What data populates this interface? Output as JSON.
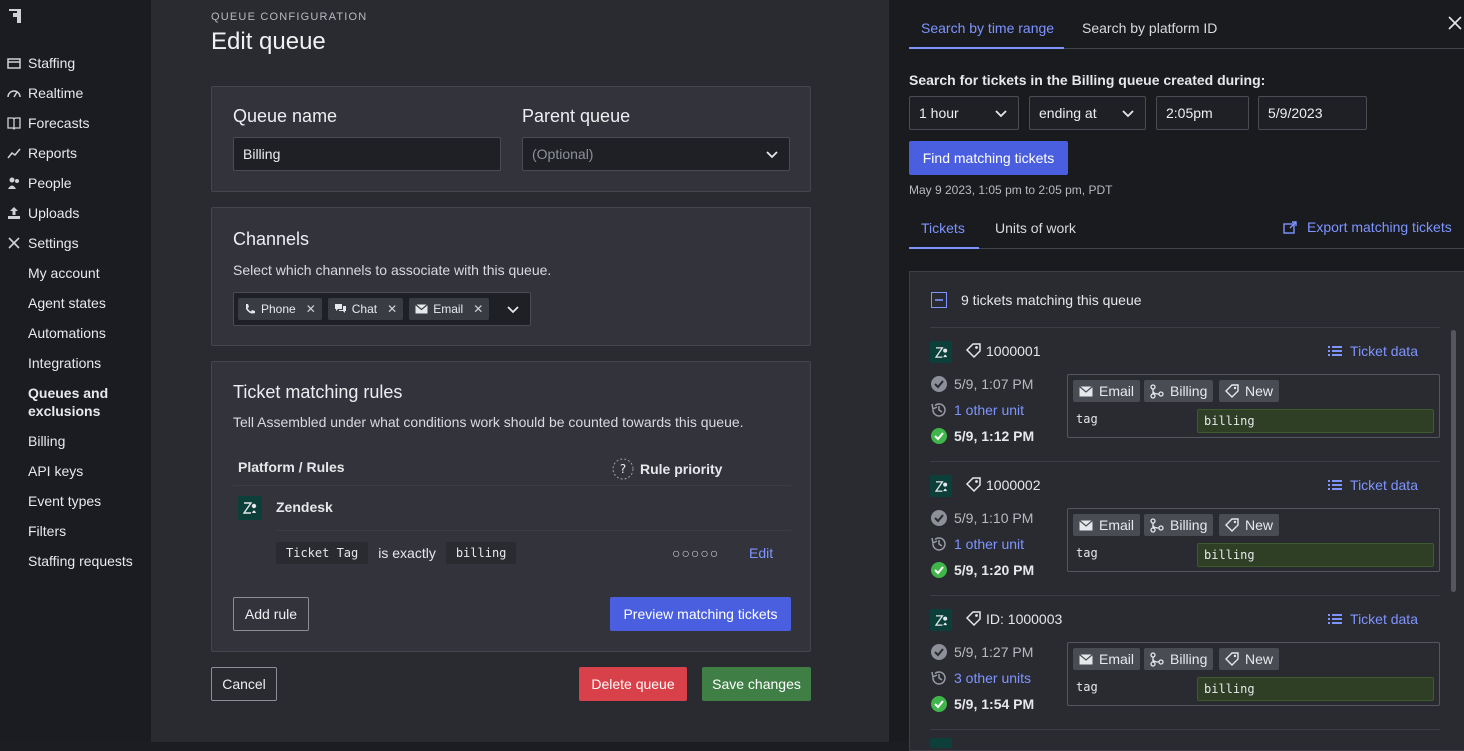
{
  "sidebar": {
    "items": [
      {
        "label": "Staffing",
        "icon": "store-icon"
      },
      {
        "label": "Realtime",
        "icon": "gauge-icon"
      },
      {
        "label": "Forecasts",
        "icon": "book-icon"
      },
      {
        "label": "Reports",
        "icon": "chart-line-icon"
      },
      {
        "label": "People",
        "icon": "people-icon"
      },
      {
        "label": "Uploads",
        "icon": "upload-icon"
      },
      {
        "label": "Settings",
        "icon": "tools-icon"
      }
    ],
    "settings_items": [
      "My account",
      "Agent states",
      "Automations",
      "Integrations",
      "Queues and exclusions",
      "Billing",
      "API keys",
      "Event types",
      "Filters",
      "Staffing requests"
    ],
    "active_item": "Queues and exclusions"
  },
  "header": {
    "eyebrow": "QUEUE CONFIGURATION",
    "title": "Edit queue"
  },
  "queue_card": {
    "name_label": "Queue name",
    "name_value": "Billing",
    "parent_label": "Parent queue",
    "parent_placeholder": "(Optional)"
  },
  "channels_card": {
    "title": "Channels",
    "help": "Select which channels to associate with this queue.",
    "chips": [
      {
        "label": "Phone",
        "icon": "phone-icon"
      },
      {
        "label": "Chat",
        "icon": "chat-icon"
      },
      {
        "label": "Email",
        "icon": "email-icon"
      }
    ]
  },
  "rules_card": {
    "title": "Ticket matching rules",
    "help": "Tell Assembled under what conditions work should be counted towards this queue.",
    "col_platform": "Platform / Rules",
    "col_priority": "Rule priority",
    "platform": "Zendesk",
    "rule": {
      "field": "Ticket Tag",
      "operator": "is exactly",
      "value": "billing",
      "priority_dots": "○○○○○",
      "edit_label": "Edit"
    },
    "add_rule": "Add rule",
    "preview": "Preview matching tickets"
  },
  "footer": {
    "cancel": "Cancel",
    "delete": "Delete queue",
    "save": "Save changes"
  },
  "panel": {
    "tabs": [
      "Search by time range",
      "Search by platform ID"
    ],
    "search_label": "Search for tickets in the Billing queue created during:",
    "duration": "1 hour",
    "mode": "ending at",
    "time": "2:05pm",
    "date": "5/9/2023",
    "find_button": "Find matching tickets",
    "range_text": "May 9 2023, 1:05 pm to 2:05 pm, PDT",
    "result_tabs": [
      "Tickets",
      "Units of work"
    ],
    "export": "Export matching tickets",
    "matching_count": "9 tickets matching this queue",
    "ticket_data_label": "Ticket data",
    "tickets": [
      {
        "id": "1000001",
        "created": "5/9, 1:07 PM",
        "units": "1 other unit",
        "resolved": "5/9, 1:12 PM",
        "chips": [
          "Email",
          "Billing",
          "New"
        ],
        "tag_key": "tag",
        "tag_value": "billing"
      },
      {
        "id": "1000002",
        "created": "5/9, 1:10 PM",
        "units": "1 other unit",
        "resolved": "5/9, 1:20 PM",
        "chips": [
          "Email",
          "Billing",
          "New"
        ],
        "tag_key": "tag",
        "tag_value": "billing"
      },
      {
        "id": "ID: 1000003",
        "created": "5/9, 1:27 PM",
        "units": "3 other units",
        "resolved": "5/9, 1:54 PM",
        "chips": [
          "Email",
          "Billing",
          "New"
        ],
        "tag_key": "tag",
        "tag_value": "billing"
      }
    ]
  },
  "colors": {
    "accent": "#7e94ff",
    "primary_button": "#4a5fe0",
    "danger": "#d9414a",
    "success": "#3f7f46",
    "zendesk": "#0c3f3a"
  }
}
